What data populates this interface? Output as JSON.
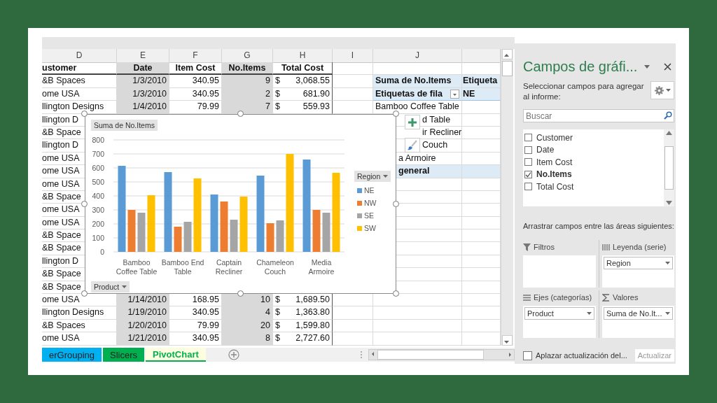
{
  "sheet": {
    "column_letters": [
      {
        "letter": "D"
      },
      {
        "letter": "E"
      },
      {
        "letter": "F"
      },
      {
        "letter": "G"
      },
      {
        "letter": "H"
      },
      {
        "letter": "I"
      },
      {
        "letter": "J"
      }
    ],
    "header": [
      {
        "text": "ustomer",
        "shaded": false
      },
      {
        "text": "Date",
        "shaded": true
      },
      {
        "text": "Item Cost",
        "shaded": false
      },
      {
        "text": "No.Items",
        "shaded": true
      },
      {
        "text": "Total Cost",
        "shaded": false
      }
    ],
    "rows": [
      {
        "customer": "&B Spaces",
        "date": "1/3/2010",
        "item_cost": "340.95",
        "no_items": "9",
        "currency": "$",
        "total_cost": "3,068.55"
      },
      {
        "customer": "ome USA",
        "date": "1/3/2010",
        "item_cost": "340.95",
        "no_items": "2",
        "currency": "$",
        "total_cost": "681.90"
      },
      {
        "customer": "llington Designs",
        "date": "1/4/2010",
        "item_cost": "79.99",
        "no_items": "7",
        "currency": "$",
        "total_cost": "559.93"
      },
      {
        "customer": "llington D"
      },
      {
        "customer": "&B Space"
      },
      {
        "customer": "llington D"
      },
      {
        "customer": "ome USA"
      },
      {
        "customer": "ome USA"
      },
      {
        "customer": "ome USA"
      },
      {
        "customer": "&B Space"
      },
      {
        "customer": "ome USA"
      },
      {
        "customer": "ome USA"
      },
      {
        "customer": "&B Space"
      },
      {
        "customer": "&B Space"
      },
      {
        "customer": "llington D"
      },
      {
        "customer": "&B Space"
      },
      {
        "customer": "&B Space"
      },
      {
        "customer": "ome USA",
        "date": "1/14/2010",
        "item_cost": "168.95",
        "no_items": "10",
        "currency": "$",
        "total_cost": "1,689.50"
      },
      {
        "customer": "llington Designs",
        "date": "1/19/2010",
        "item_cost": "340.95",
        "no_items": "4",
        "currency": "$",
        "total_cost": "1,363.80"
      },
      {
        "customer": "&B Spaces",
        "date": "1/20/2010",
        "item_cost": "79.99",
        "no_items": "20",
        "currency": "$",
        "total_cost": "1,599.80"
      },
      {
        "customer": "ome USA",
        "date": "1/21/2010",
        "item_cost": "340.95",
        "no_items": "8",
        "currency": "$",
        "total_cost": "2,727.60"
      }
    ]
  },
  "pivot_table": {
    "value_field": "Suma de No.Items",
    "column_header": "Etiqueta",
    "row_label_header": "Etiquetas de fila",
    "column_value": "NE",
    "rows": [
      {
        "label": "Bamboo Coffee Table",
        "kind": "item"
      },
      {
        "label": "d Table",
        "kind": "item"
      },
      {
        "label": "ir Recliner",
        "kind": "item"
      },
      {
        "label": "Couch",
        "kind": "item"
      },
      {
        "label": "a Armoire",
        "kind": "item"
      },
      {
        "label": "general",
        "kind": "total"
      }
    ]
  },
  "chart": {
    "value_button": "Suma de No.Items",
    "legend_button": "Region",
    "axis_button": "Product",
    "chart_data": {
      "type": "bar",
      "categories": [
        "Bamboo Coffee Table",
        "Bamboo End Table",
        "Captain Recliner",
        "Chameleon Couch",
        "Media Armoire"
      ],
      "series": [
        {
          "name": "NE",
          "color": "#5b9bd5",
          "values": [
            615,
            570,
            410,
            545,
            660
          ]
        },
        {
          "name": "NW",
          "color": "#ed7d31",
          "values": [
            300,
            180,
            360,
            205,
            300
          ]
        },
        {
          "name": "SE",
          "color": "#a5a5a5",
          "values": [
            280,
            215,
            230,
            225,
            280
          ]
        },
        {
          "name": "SW",
          "color": "#ffc000",
          "values": [
            405,
            525,
            395,
            700,
            565
          ]
        }
      ],
      "ylim": [
        0,
        800
      ],
      "yticks": [
        0,
        100,
        200,
        300,
        400,
        500,
        600,
        700,
        800
      ],
      "grid": true,
      "legend": true
    }
  },
  "sheet_tabs": [
    {
      "label": "erGrouping",
      "color": "#00b0f0",
      "selected": false
    },
    {
      "label": "Slicers",
      "color": "#00b050",
      "selected": false
    },
    {
      "label": "PivotChart",
      "color": "#00b050",
      "selected": true
    }
  ],
  "field_pane": {
    "title": "Campos de gráfi...",
    "instruction": "Seleccionar campos para agregar al informe:",
    "search": {
      "placeholder": "Buscar"
    },
    "fields": [
      {
        "name": "Customer",
        "checked": false
      },
      {
        "name": "Date",
        "checked": false
      },
      {
        "name": "Item Cost",
        "checked": false
      },
      {
        "name": "No.Items",
        "checked": true
      },
      {
        "name": "Total Cost",
        "checked": false
      }
    ],
    "areas_hint": "Arrastrar campos entre las áreas siguientes:",
    "areas": [
      {
        "kind": "filters",
        "title": "Filtros"
      },
      {
        "kind": "legend",
        "title": "Leyenda (serie)",
        "items": [
          "Region"
        ]
      },
      {
        "kind": "axis",
        "title": "Ejes (categorías)",
        "items": [
          "Product"
        ]
      },
      {
        "kind": "values",
        "title": "Valores",
        "items": [
          "Suma de No.It..."
        ]
      }
    ],
    "defer": {
      "label": "Aplazar actualización del...",
      "checked": false
    },
    "update_button": {
      "label": "Actualizar",
      "disabled": true
    }
  }
}
